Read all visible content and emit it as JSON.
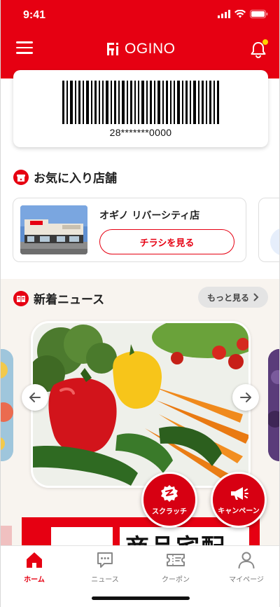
{
  "status_bar": {
    "time": "9:41"
  },
  "header": {
    "logo_text": "OGINO"
  },
  "member_card": {
    "barcode_number": "28*******0000"
  },
  "favorite_stores": {
    "title": "お気に入り店舗",
    "stores": [
      {
        "name": "オギノ リバーシティ店",
        "flyer_button": "チラシを見る"
      }
    ]
  },
  "news": {
    "title": "新着ニュース",
    "more_button": "もっと見る"
  },
  "floating_buttons": {
    "scratch": "スクラッチ",
    "campaign": "キャンペーン"
  },
  "promo_banner": {
    "text": "商品宅配"
  },
  "tab_bar": {
    "tabs": [
      {
        "label": "ホーム",
        "icon": "home-icon",
        "active": true
      },
      {
        "label": "ニュース",
        "icon": "chat-bubble-icon",
        "active": false
      },
      {
        "label": "クーポン",
        "icon": "ticket-icon",
        "active": false
      },
      {
        "label": "マイページ",
        "icon": "person-icon",
        "active": false
      }
    ]
  },
  "colors": {
    "brand_red": "#e60012",
    "notification_dot": "#ffd400"
  }
}
